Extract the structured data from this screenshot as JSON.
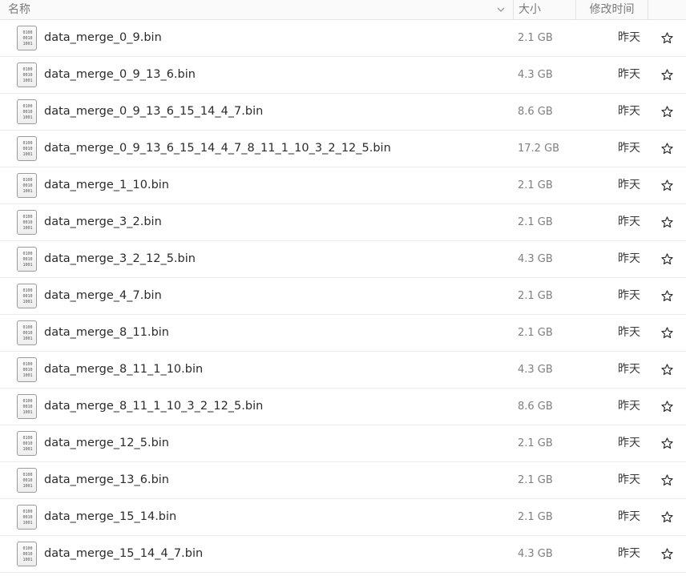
{
  "header": {
    "name": "名称",
    "size": "大小",
    "modified": "修改时间"
  },
  "files": [
    {
      "name": "data_merge_0_9.bin",
      "size": "2.1 GB",
      "modified": "昨天",
      "icon": "binary-file-icon",
      "starred": false
    },
    {
      "name": "data_merge_0_9_13_6.bin",
      "size": "4.3 GB",
      "modified": "昨天",
      "icon": "binary-file-icon",
      "starred": false
    },
    {
      "name": "data_merge_0_9_13_6_15_14_4_7.bin",
      "size": "8.6 GB",
      "modified": "昨天",
      "icon": "binary-file-icon",
      "starred": false
    },
    {
      "name": "data_merge_0_9_13_6_15_14_4_7_8_11_1_10_3_2_12_5.bin",
      "size": "17.2 GB",
      "modified": "昨天",
      "icon": "binary-file-icon",
      "starred": false
    },
    {
      "name": "data_merge_1_10.bin",
      "size": "2.1 GB",
      "modified": "昨天",
      "icon": "binary-file-icon",
      "starred": false
    },
    {
      "name": "data_merge_3_2.bin",
      "size": "2.1 GB",
      "modified": "昨天",
      "icon": "binary-file-icon",
      "starred": false
    },
    {
      "name": "data_merge_3_2_12_5.bin",
      "size": "4.3 GB",
      "modified": "昨天",
      "icon": "binary-file-icon",
      "starred": false
    },
    {
      "name": "data_merge_4_7.bin",
      "size": "2.1 GB",
      "modified": "昨天",
      "icon": "binary-file-icon",
      "starred": false
    },
    {
      "name": "data_merge_8_11.bin",
      "size": "2.1 GB",
      "modified": "昨天",
      "icon": "binary-file-icon",
      "starred": false
    },
    {
      "name": "data_merge_8_11_1_10.bin",
      "size": "4.3 GB",
      "modified": "昨天",
      "icon": "binary-file-icon",
      "starred": false
    },
    {
      "name": "data_merge_8_11_1_10_3_2_12_5.bin",
      "size": "8.6 GB",
      "modified": "昨天",
      "icon": "binary-file-icon",
      "starred": false
    },
    {
      "name": "data_merge_12_5.bin",
      "size": "2.1 GB",
      "modified": "昨天",
      "icon": "binary-file-icon",
      "starred": false
    },
    {
      "name": "data_merge_13_6.bin",
      "size": "2.1 GB",
      "modified": "昨天",
      "icon": "binary-file-icon",
      "starred": false
    },
    {
      "name": "data_merge_15_14.bin",
      "size": "2.1 GB",
      "modified": "昨天",
      "icon": "binary-file-icon",
      "starred": false
    },
    {
      "name": "data_merge_15_14_4_7.bin",
      "size": "4.3 GB",
      "modified": "昨天",
      "icon": "binary-file-icon",
      "starred": false
    }
  ],
  "binary_glyph_lines": [
    "0100",
    "0010",
    "1001"
  ]
}
